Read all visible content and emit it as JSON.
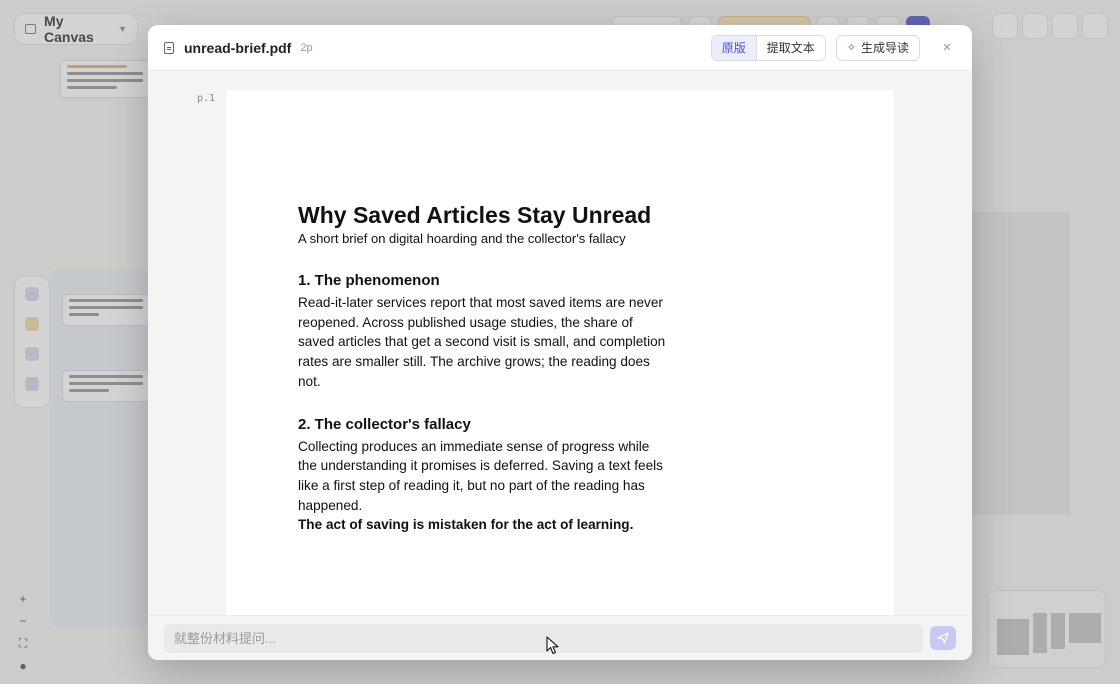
{
  "background": {
    "canvas_title": "My Canvas",
    "toolbar": {
      "model_label": "Mod...",
      "credits_label": "Contact us"
    }
  },
  "modal": {
    "file_name": "unread-brief.pdf",
    "page_count": "2p",
    "view_tabs": {
      "original": "原版",
      "extract": "提取文本"
    },
    "guide_button": "生成导读",
    "close_icon": "×",
    "page_label": "p.1",
    "document": {
      "title": "Why Saved Articles Stay Unread",
      "subtitle": "A short brief on digital hoarding and the collector's fallacy",
      "sections": [
        {
          "heading": "1. The phenomenon",
          "body": "Read-it-later services report that most saved items are never reopened. Across published usage studies, the share of saved articles that get a second visit is small, and completion rates are smaller still. The archive grows; the reading does not."
        },
        {
          "heading": "2. The collector's fallacy",
          "body": "Collecting produces an immediate sense of progress while the understanding it promises is deferred. Saving a text feels like a first step of reading it, but no part of the reading has happened.",
          "emphasis": "The act of saving is mistaken for the act of learning."
        }
      ]
    },
    "footer": {
      "input_placeholder": "就整份材料提问...",
      "input_value": ""
    }
  },
  "colors": {
    "accent": "#4b4fd0",
    "accent_light": "#eceefc",
    "send_button": "#c8c9f2",
    "credits_badge": "#fce9c8"
  },
  "icons": [
    "folder-icon",
    "chevron-down-icon",
    "document-icon",
    "sparkle-icon",
    "close-icon",
    "send-icon",
    "mouse-cursor-icon",
    "plus-icon",
    "minus-icon",
    "fit-icon"
  ]
}
